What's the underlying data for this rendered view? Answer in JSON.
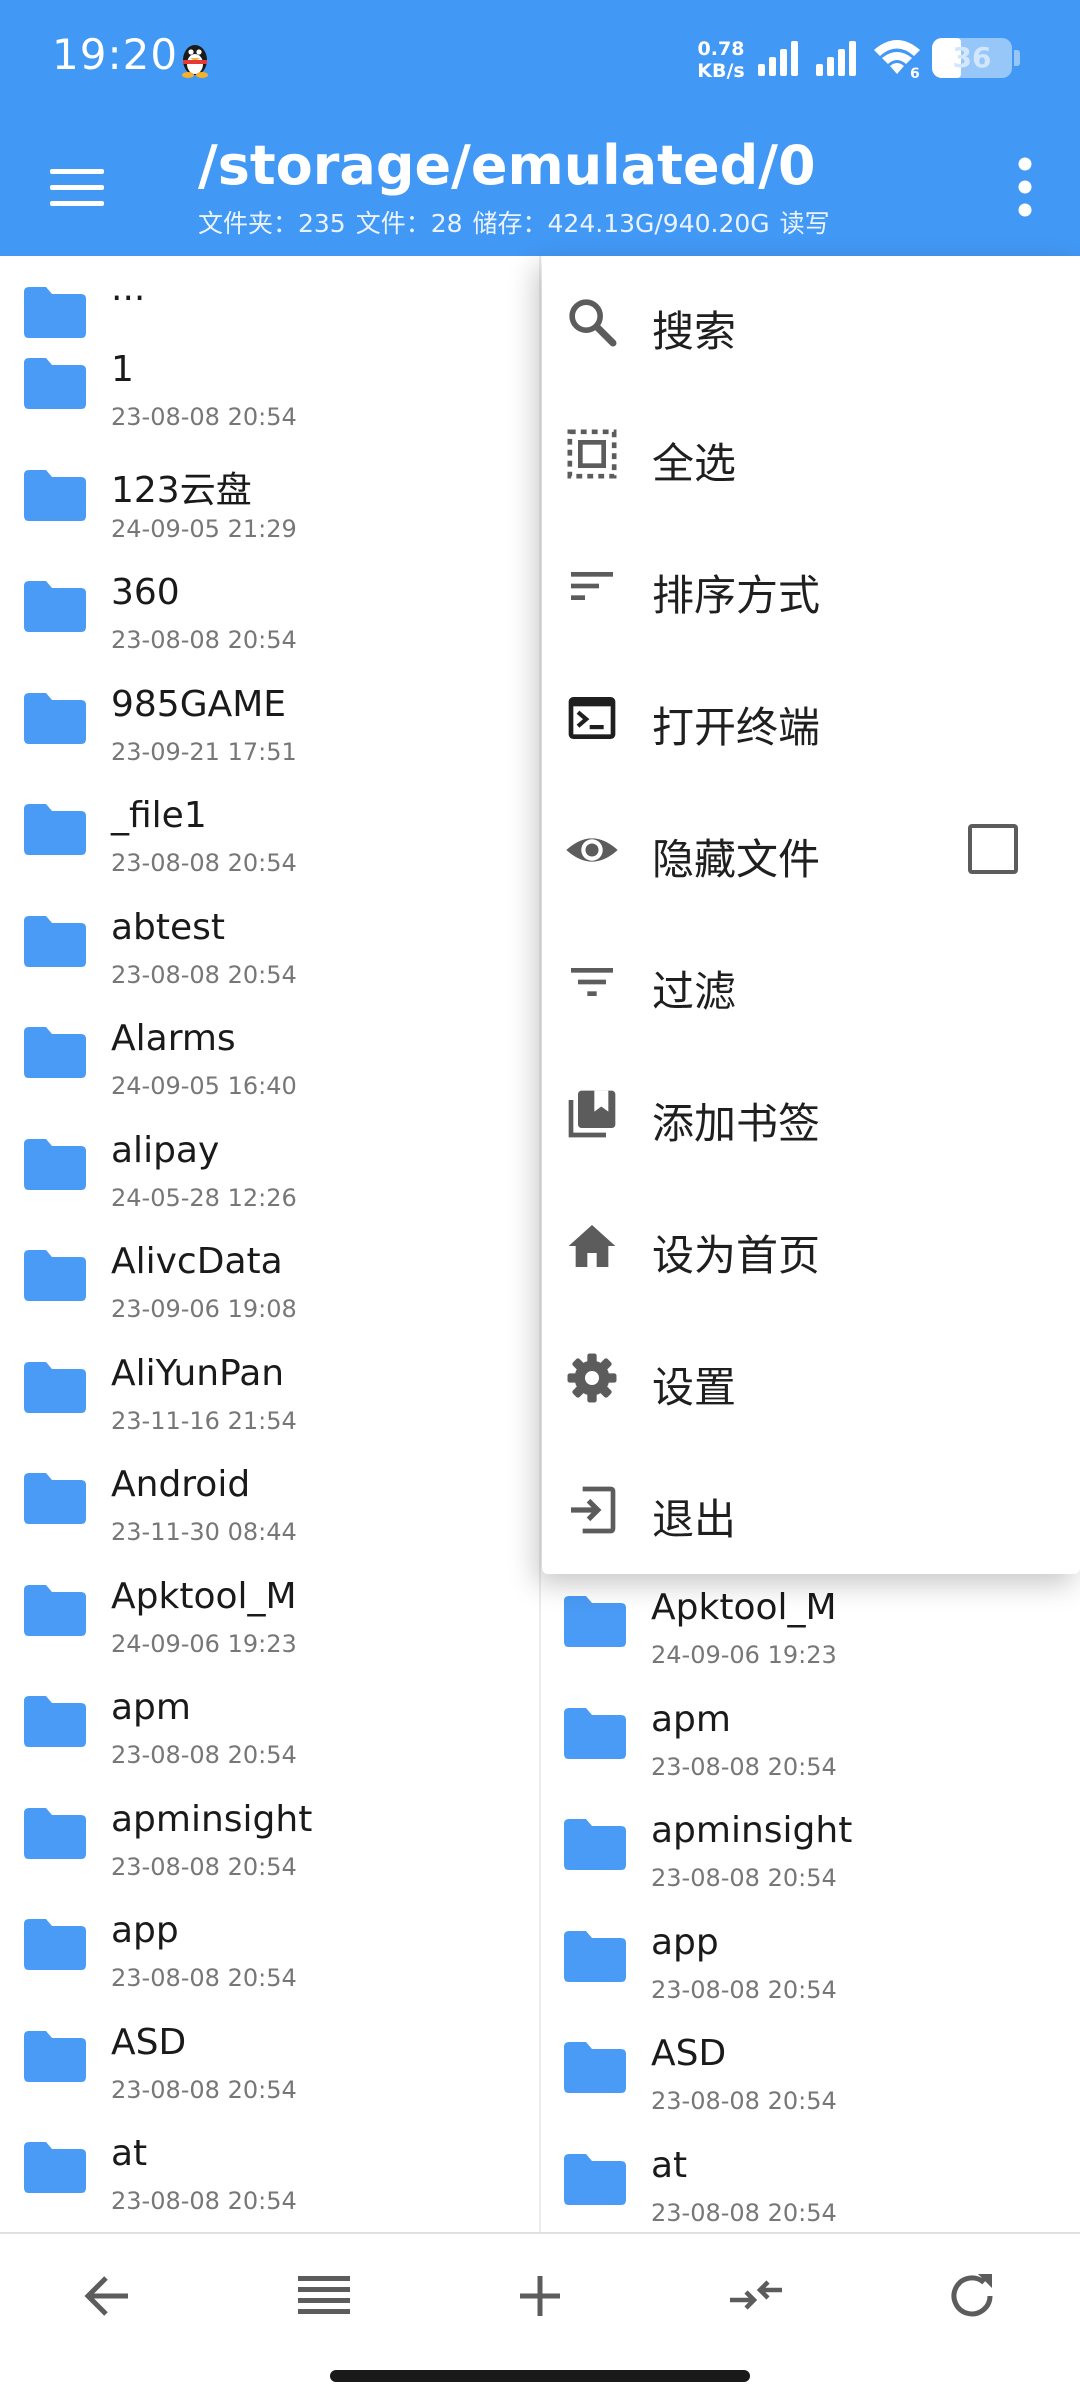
{
  "status_bar": {
    "time": "19:20",
    "net_speed_value": "0.78",
    "net_speed_unit": "KB/s",
    "battery_level": "36",
    "battery_percent": 36,
    "wifi_badge": "6"
  },
  "toolbar": {
    "path": "/storage/emulated/0",
    "folders_label": "文件夹：235",
    "files_label": "文件：28",
    "storage_label": "储存：424.13G/940.20G",
    "mode_label": "读写"
  },
  "left_pane": {
    "parent_label": "...",
    "rows": [
      {
        "name": "1",
        "date": "23-08-08 20:54"
      },
      {
        "name": "123云盘",
        "date": "24-09-05 21:29"
      },
      {
        "name": "360",
        "date": "23-08-08 20:54"
      },
      {
        "name": "985GAME",
        "date": "23-09-21 17:51"
      },
      {
        "name": "_file1",
        "date": "23-08-08 20:54"
      },
      {
        "name": "abtest",
        "date": "23-08-08 20:54"
      },
      {
        "name": "Alarms",
        "date": "24-09-05 16:40"
      },
      {
        "name": "alipay",
        "date": "24-05-28 12:26"
      },
      {
        "name": "AlivcData",
        "date": "23-09-06 19:08"
      },
      {
        "name": "AliYunPan",
        "date": "23-11-16 21:54"
      },
      {
        "name": "Android",
        "date": "23-11-30 08:44"
      },
      {
        "name": "Apktool_M",
        "date": "24-09-06 19:23"
      },
      {
        "name": "apm",
        "date": "23-08-08 20:54"
      },
      {
        "name": "apminsight",
        "date": "23-08-08 20:54"
      },
      {
        "name": "app",
        "date": "23-08-08 20:54"
      },
      {
        "name": "ASD",
        "date": "23-08-08 20:54"
      },
      {
        "name": "at",
        "date": "23-08-08 20:54"
      }
    ]
  },
  "right_pane": {
    "rows": [
      {
        "name": "Apktool_M",
        "date": "24-09-06 19:23"
      },
      {
        "name": "apm",
        "date": "23-08-08 20:54"
      },
      {
        "name": "apminsight",
        "date": "23-08-08 20:54"
      },
      {
        "name": "app",
        "date": "23-08-08 20:54"
      },
      {
        "name": "ASD",
        "date": "23-08-08 20:54"
      },
      {
        "name": "at",
        "date": "23-08-08 20:54"
      }
    ]
  },
  "menu": {
    "items": [
      {
        "label": "搜索",
        "icon": "search-icon"
      },
      {
        "label": "全选",
        "icon": "select-all-icon"
      },
      {
        "label": "排序方式",
        "icon": "sort-icon"
      },
      {
        "label": "打开终端",
        "icon": "terminal-icon"
      },
      {
        "label": "隐藏文件",
        "icon": "eye-icon",
        "checked": false
      },
      {
        "label": "过滤",
        "icon": "filter-icon"
      },
      {
        "label": "添加书签",
        "icon": "bookmark-icon"
      },
      {
        "label": "设为首页",
        "icon": "home-icon"
      },
      {
        "label": "设置",
        "icon": "gear-icon"
      },
      {
        "label": "退出",
        "icon": "exit-icon"
      }
    ]
  },
  "bottom_bar": {
    "buttons": [
      "back-arrow-icon",
      "list-view-icon",
      "plus-icon",
      "swap-icon",
      "refresh-icon"
    ]
  },
  "colors": {
    "accent": "#4298f5",
    "folder": "#4a9bf5",
    "icon_gray": "#5c5c5c"
  }
}
